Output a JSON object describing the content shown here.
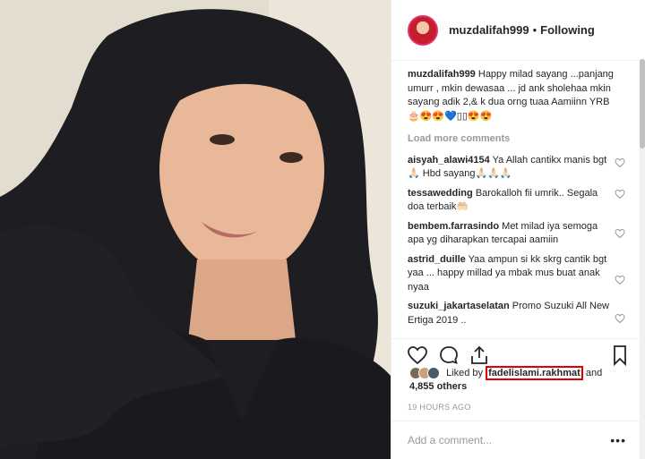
{
  "post": {
    "username": "muzdalifah999",
    "follow_label": "Following",
    "dot": "•"
  },
  "caption": {
    "username": "muzdalifah999",
    "text": "Happy milad sayang ...panjang umurr , mkin dewasaa ... jd ank sholehaa mkin sayang adik 2,& k dua orng tuaa Aamiinn YRB 🎂😍😍💙▯▯😍😍"
  },
  "load_more": "Load more comments",
  "comments": [
    {
      "user": "aisyah_alawi4154",
      "text": "Ya Allah cantikx manis bgt🙏🏻 Hbd sayang🙏🏻🙏🏻🙏🏻"
    },
    {
      "user": "tessawedding",
      "text": "Barokalloh fii umrik.. Segala doa terbaik🤲🏻"
    },
    {
      "user": "bembem.farrasindo",
      "text": "Met milad iya semoga apa yg diharapkan tercapai aamiin"
    },
    {
      "user": "astrid_duille",
      "text": "Yaa ampun si kk skrg cantik bgt yaa ... happy millad ya mbak mus buat anak nyaa"
    },
    {
      "user": "suzuki_jakartaselatan",
      "text": "Promo Suzuki All New Ertiga 2019 .."
    }
  ],
  "likes": {
    "prefix": "Liked by",
    "user": "fadelislami.rakhmat",
    "suffix": "and",
    "others": "4,855 others"
  },
  "timestamp": "19 HOURS AGO",
  "add_comment": {
    "placeholder": "Add a comment..."
  },
  "more_label": "•••",
  "icons": {
    "like": "heart-icon",
    "comment": "comment-icon",
    "share": "share-icon",
    "save": "bookmark-icon"
  },
  "colors": {
    "accent": "#e1306c",
    "highlight": "#e00000"
  }
}
